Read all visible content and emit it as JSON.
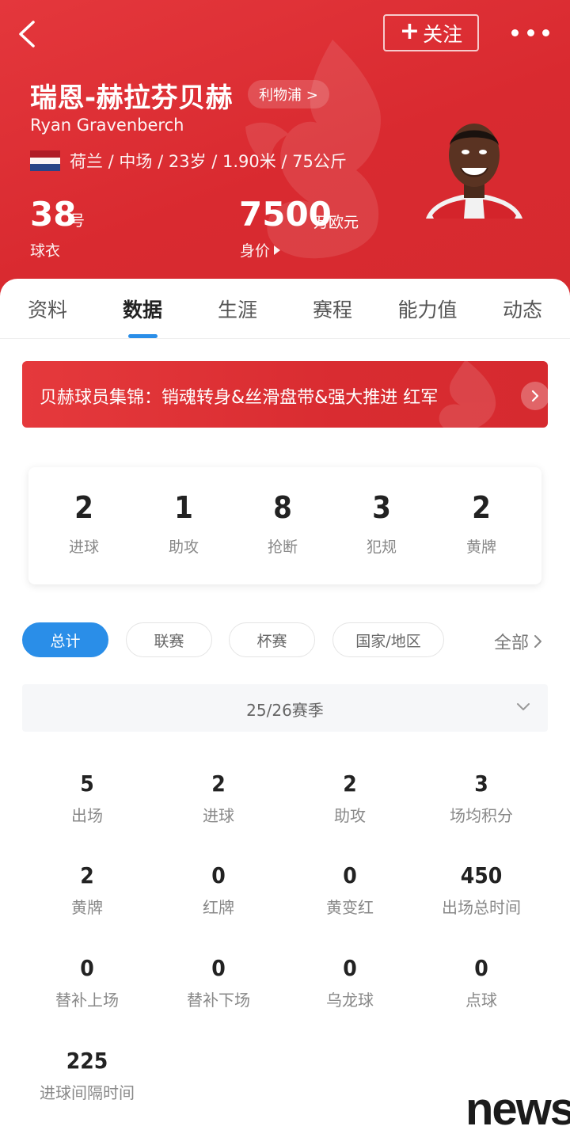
{
  "header": {
    "follow_label": "关注",
    "player_name_cn": "瑞恩-赫拉芬贝赫",
    "club": "利物浦 >",
    "player_name_en": "Ryan Gravenberch",
    "info": "荷兰 / 中场 / 23岁 / 1.90米 / 75公斤",
    "jersey_number": "38",
    "jersey_unit": "号",
    "jersey_label": "球衣",
    "market_value": "7500",
    "market_value_unit": "万欧元",
    "market_value_label": "身价",
    "flag_colors": [
      "#ae1c28",
      "#ffffff",
      "#21468b"
    ],
    "accent_color": "#d92a30"
  },
  "tabs": [
    "资料",
    "数据",
    "生涯",
    "赛程",
    "能力值",
    "动态"
  ],
  "active_tab": "数据",
  "banner": {
    "text": "贝赫球员集锦：销魂转身&丝滑盘带&强大推进 红军"
  },
  "summary": [
    {
      "value": "2",
      "label": "进球"
    },
    {
      "value": "1",
      "label": "助攻"
    },
    {
      "value": "8",
      "label": "抢断"
    },
    {
      "value": "3",
      "label": "犯规"
    },
    {
      "value": "2",
      "label": "黄牌"
    }
  ],
  "filters": {
    "chips": [
      "总计",
      "联赛",
      "杯赛",
      "国家/地区"
    ],
    "active": "总计",
    "all_label": "全部"
  },
  "season": "25/26赛季",
  "stats": [
    {
      "value": "5",
      "label": "出场"
    },
    {
      "value": "2",
      "label": "进球"
    },
    {
      "value": "2",
      "label": "助攻"
    },
    {
      "value": "3",
      "label": "场均积分"
    },
    {
      "value": "2",
      "label": "黄牌"
    },
    {
      "value": "0",
      "label": "红牌"
    },
    {
      "value": "0",
      "label": "黄变红"
    },
    {
      "value": "450",
      "label": "出场总时间"
    },
    {
      "value": "0",
      "label": "替补上场"
    },
    {
      "value": "0",
      "label": "替补下场"
    },
    {
      "value": "0",
      "label": "乌龙球"
    },
    {
      "value": "0",
      "label": "点球"
    },
    {
      "value": "225",
      "label": "进球间隔时间"
    }
  ],
  "watermark": "news",
  "colors": {
    "brand_red": "#d92a30",
    "active_blue": "#2a8ee8"
  }
}
